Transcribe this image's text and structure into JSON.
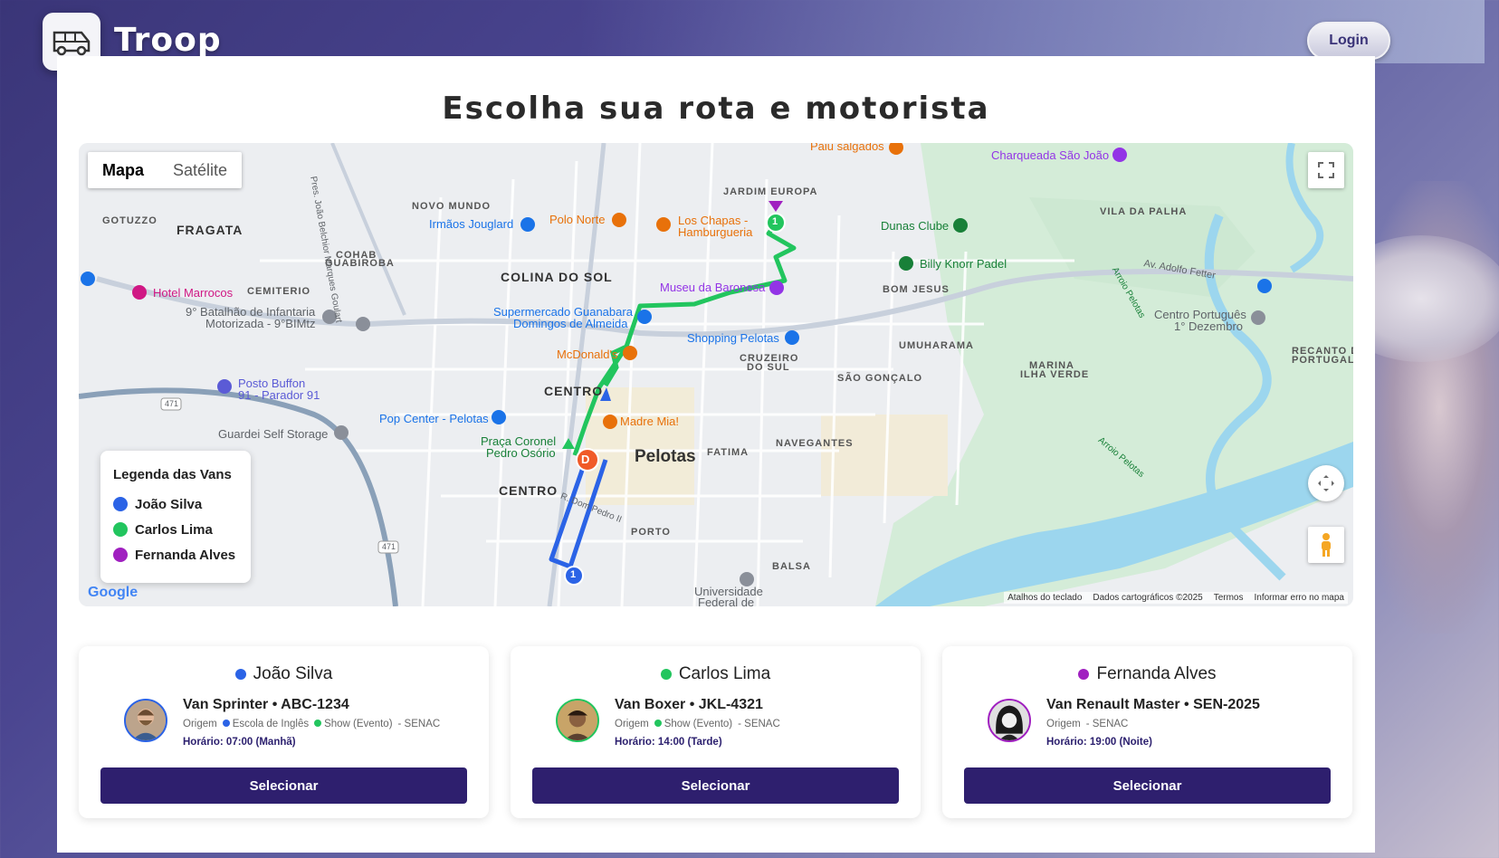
{
  "app": {
    "name": "Troop",
    "login_label": "Login"
  },
  "page": {
    "title": "Escolha sua rota e motorista"
  },
  "map": {
    "tabs": [
      {
        "label": "Mapa",
        "active": true
      },
      {
        "label": "Satélite",
        "active": false
      }
    ],
    "legend": {
      "title": "Legenda das Vans",
      "items": [
        {
          "label": "João Silva",
          "color": "#2b63e6"
        },
        {
          "label": "Carlos Lima",
          "color": "#22c55e"
        },
        {
          "label": "Fernanda Alves",
          "color": "#a020c0"
        }
      ]
    },
    "labels": {
      "charqueada": "Charqueada São João",
      "paiu": "Paiu salgados",
      "jardim": "JARDIM EUROPA",
      "vila_palha": "VILA DA PALHA",
      "gotuzzo": "GOTUZZO",
      "fragata": "FRAGATA",
      "novo_mundo": "NOVO MUNDO",
      "irmaos": "Irmãos Jouglard",
      "polo_norte": "Polo Norte",
      "los_chapas": "Los Chapas -",
      "los_chapas2": "Hamburgueria",
      "dunas": "Dunas Clube",
      "cohab": "COHAB",
      "guabiroba": "GUABIROBA",
      "colina": "COLINA DO SOL",
      "billy": "Billy Knorr Padel",
      "adolfo": "Av. Adolfo Fetter",
      "hotel": "Hotel Marrocos",
      "cemiterio": "CEMITERIO",
      "museu": "Museu da Baronesa",
      "bom_jesus": "BOM JESUS",
      "batalhao": "9° Batalhão de Infantaria",
      "batalhao2": "Motorizada - 9°BIMtz",
      "supermercado": "Supermercado Guanabara",
      "supermercado2": "Domingos de Almeida",
      "centro_portugues": "Centro Português",
      "centro_portugues2": "1° Dezembro",
      "shopping": "Shopping Pelotas",
      "umuharama": "UMUHARAMA",
      "mcdonalds": "McDonald's",
      "cruzeiro": "CRUZEIRO",
      "cruzeiro2": "DO SUL",
      "marina": "MARINA",
      "marina2": "ILHA VERDE",
      "recanto": "RECANTO D",
      "recanto2": "PORTUGAL",
      "posto": "Posto Buffon",
      "posto2": "91 - Parador 91",
      "centro": "CENTRO",
      "sao_goncalo": "SÃO GONÇALO",
      "pop_center": "Pop Center - Pelotas",
      "madre_mia": "Madre Mia!",
      "guardei": "Guardei Self Storage",
      "praca": "Praça Coronel",
      "praca2": "Pedro Osório",
      "pelotas": "Pelotas",
      "fatima": "FATIMA",
      "navegantes": "NAVEGANTES",
      "centro2": "CENTRO",
      "porto": "PORTO",
      "balsa": "BALSA",
      "universidade": "Universidade",
      "universidade2": "Federal de",
      "arroio1": "Arroio Pelotas",
      "arroio2": "Arroio Pelotas",
      "road_471a": "471",
      "road_471b": "471",
      "rua_pedro": "R. Dom Pedro II",
      "pres_joao": "Pres. João Belchior Marques Goulart"
    },
    "marker_d": "D",
    "marker_1": "1",
    "google": "Google",
    "attribution": [
      "Atalhos do teclado",
      "Dados cartográficos ©2025",
      "Termos",
      "Informar erro no mapa"
    ]
  },
  "drivers": [
    {
      "name": "João Silva",
      "color": "#2b63e6",
      "vehicle": "Van Sprinter • ABC-1234",
      "origin_label": "Origem",
      "stops": [
        {
          "label": "Escola de Inglês",
          "color": "#2b63e6"
        },
        {
          "label": "Show (Evento)",
          "color": "#22c55e"
        }
      ],
      "destination": "- SENAC",
      "time": "Horário: 07:00 (Manhã)",
      "button": "Selecionar"
    },
    {
      "name": "Carlos Lima",
      "color": "#22c55e",
      "vehicle": "Van Boxer • JKL-4321",
      "origin_label": "Origem",
      "stops": [
        {
          "label": "Show (Evento)",
          "color": "#22c55e"
        }
      ],
      "destination": "- SENAC",
      "time": "Horário: 14:00 (Tarde)",
      "button": "Selecionar"
    },
    {
      "name": "Fernanda Alves",
      "color": "#a020c0",
      "vehicle": "Van Renault Master • SEN-2025",
      "origin_label": "Origem",
      "stops": [],
      "destination": "- SENAC",
      "time": "Horário: 19:00 (Noite)",
      "button": "Selecionar"
    }
  ]
}
